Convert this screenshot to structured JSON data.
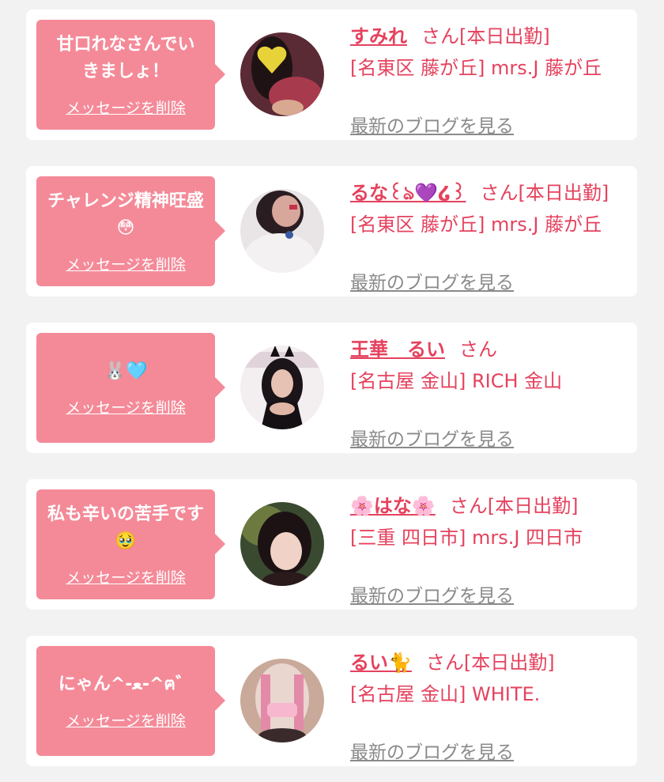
{
  "colors": {
    "accent": "#e5425e",
    "bubble": "#f48a98",
    "muted": "#8a8a8a",
    "background": "#f2f2f2"
  },
  "cards": [
    {
      "message": "甘口れなさんでいきましょ！",
      "delete_label": "メッセージを削除",
      "name": "すみれ",
      "san": "さん",
      "status": "[本日出勤]",
      "shop": "[名東区 藤が丘] mrs.J 藤が丘",
      "blog_label": "最新のブログを見る"
    },
    {
      "message": "チャレンジ精神旺盛😳",
      "delete_label": "メッセージを削除",
      "name": "るな꒰ঌ💜໒꒱",
      "san": "さん",
      "status": "[本日出勤]",
      "shop": "[名東区 藤が丘] mrs.J 藤が丘",
      "blog_label": "最新のブログを見る"
    },
    {
      "message": "🐰🩵",
      "delete_label": "メッセージを削除",
      "name": "王華　るい",
      "san": "さん",
      "status": "",
      "shop": "[名古屋 金山] RICH 金山",
      "blog_label": "最新のブログを見る"
    },
    {
      "message": "私も辛いの苦手です🥹",
      "delete_label": "メッセージを削除",
      "name": "🌸はな🌸",
      "san": "さん",
      "status": "[本日出勤]",
      "shop": "[三重 四日市] mrs.J 四日市",
      "blog_label": "最新のブログを見る"
    },
    {
      "message": "にゃん^-ﻌ-^ฅ゛",
      "delete_label": "メッセージを削除",
      "name": "るい🐈",
      "san": "さん",
      "status": "[本日出勤]",
      "shop": "[名古屋 金山] WHITE.",
      "blog_label": "最新のブログを見る"
    }
  ]
}
